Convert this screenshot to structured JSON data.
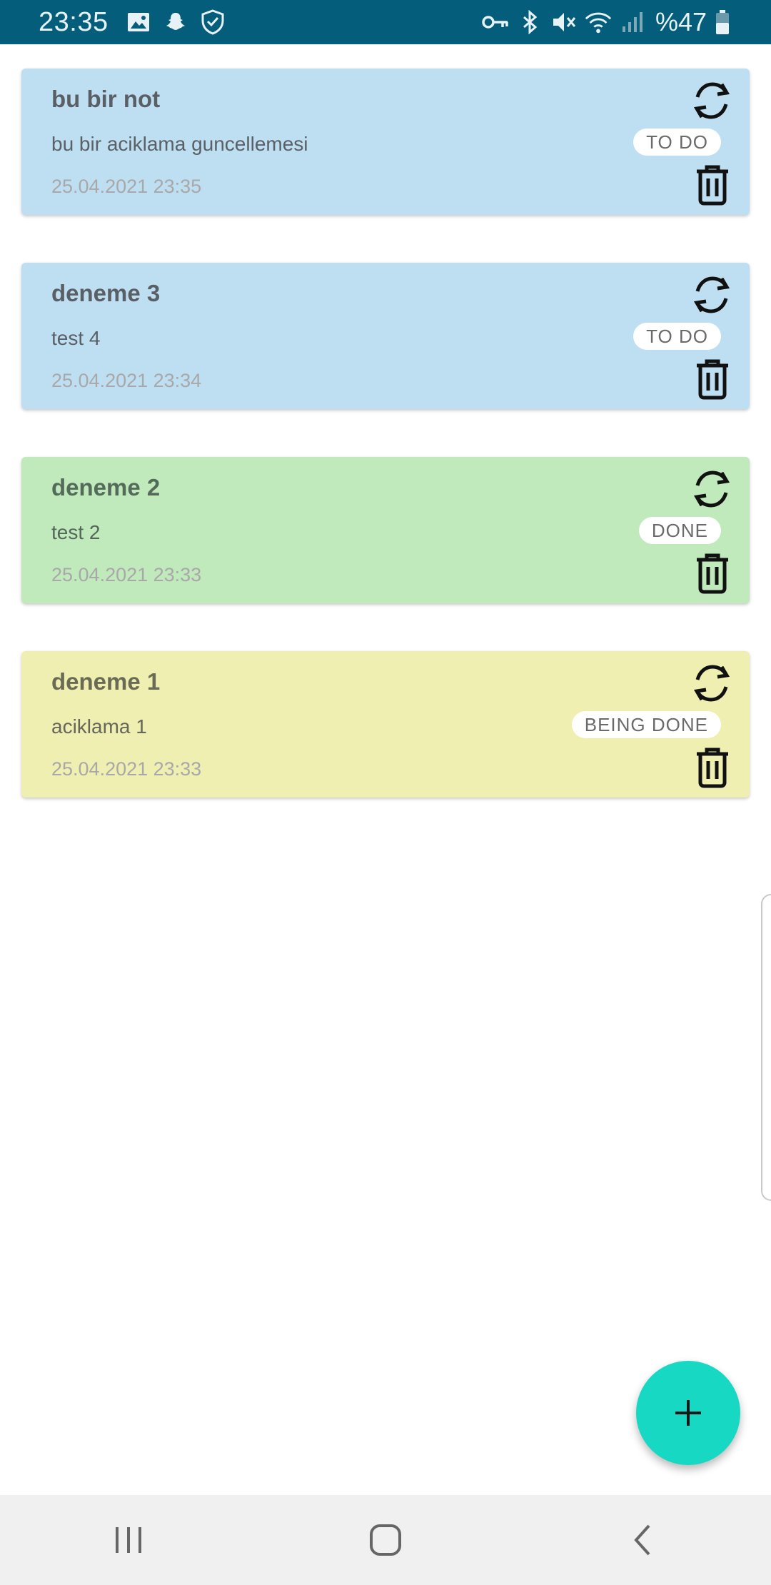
{
  "status_bar": {
    "time": "23:35",
    "battery": "%47",
    "icons_left": [
      "gallery-icon",
      "snapchat-icon",
      "shield-check-icon"
    ],
    "icons_right": [
      "vpn-key-icon",
      "bluetooth-icon",
      "mute-icon",
      "wifi-icon",
      "signal-icon",
      "battery-icon"
    ]
  },
  "notes": [
    {
      "title": "bu bir not",
      "description": "bu bir aciklama guncellemesi",
      "date": "25.04.2021 23:35",
      "status": "TO DO",
      "color": "#bedff2"
    },
    {
      "title": "deneme 3",
      "description": "test 4",
      "date": "25.04.2021 23:34",
      "status": "TO DO",
      "color": "#bedff2"
    },
    {
      "title": "deneme 2",
      "description": "test 2",
      "date": "25.04.2021 23:33",
      "status": "DONE",
      "color": "#c0e9bc"
    },
    {
      "title": "deneme 1",
      "description": "aciklama 1",
      "date": "25.04.2021 23:33",
      "status": "BEING DONE",
      "color": "#efefb2"
    }
  ],
  "fab": {
    "icon": "plus-icon",
    "color": "#16d8c3"
  },
  "nav_bar": {
    "buttons": [
      "recents-icon",
      "home-icon",
      "back-icon"
    ]
  }
}
